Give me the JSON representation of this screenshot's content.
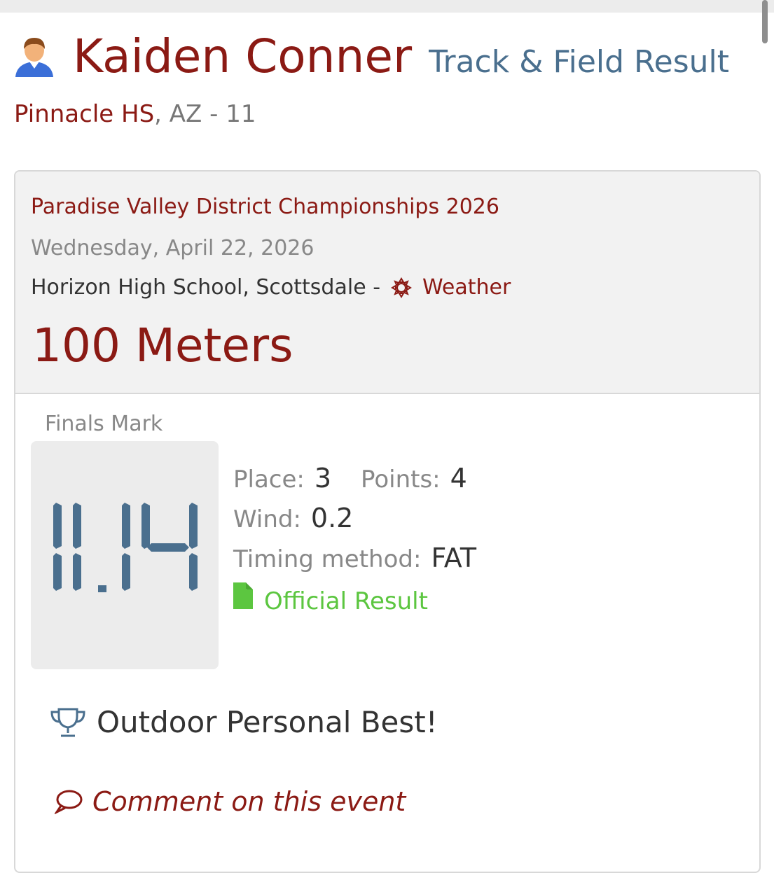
{
  "header": {
    "avatar_icon": "person-avatar-icon",
    "athlete_name": "Kaiden Conner",
    "subtitle": "Track & Field Result"
  },
  "school": {
    "name": "Pinnacle HS",
    "state_grade": ", AZ - 11"
  },
  "meet": {
    "name": "Paradise Valley District Championships 2026",
    "date": "Wednesday, April 22, 2026",
    "venue": "Horizon High School, Scottsdale -",
    "weather_icon": "sun-icon",
    "weather_label": "Weather",
    "event": "100 Meters"
  },
  "result": {
    "finals_label": "Finals Mark",
    "mark": "11.14",
    "place_label": "Place:",
    "place": "3",
    "points_label": "Points:",
    "points": "4",
    "wind_label": "Wind:",
    "wind": "0.2",
    "timing_label": "Timing method:",
    "timing": "FAT",
    "official_icon": "document-icon",
    "official_label": "Official Result"
  },
  "badges": {
    "trophy_icon": "trophy-icon",
    "personal_best": "Outdoor Personal Best!"
  },
  "comment": {
    "icon": "speech-bubble-icon",
    "label": "Comment on this event"
  },
  "colors": {
    "maroon": "#8b1a14",
    "steel_blue": "#4a6f8e",
    "green": "#5cc640",
    "panel": "#f2f2f2"
  }
}
